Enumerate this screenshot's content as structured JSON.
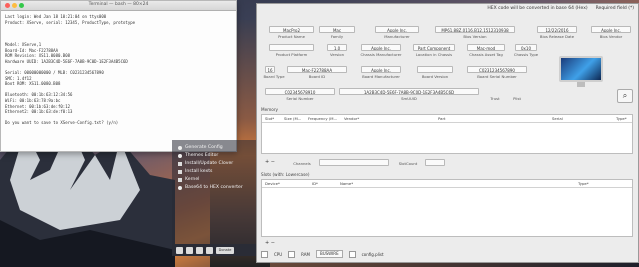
{
  "terminal": {
    "title": "Terminal — bash — 80×24",
    "lines": [
      "Last login: Wed Jan 18 10:21:04 on ttys000",
      "Product: XServe, serial: 12345, ProductType, prototype",
      "",
      "",
      "",
      "Model: XServe,1",
      "Board-Id: Mac-F22788AA",
      "ROM Revision: XS11.0080.B08",
      "Hardware UUID: 1A2B3C4D-5E6F-7A8B-9C0D-1E2F3A4B5C6D",
      "",
      "Serial: 00000000000 / MLB: C0231234567890",
      "SMC: 1.4f12",
      "Boot ROM: XS11.0080.B08",
      "",
      "Bluetooth: 00:1b:63:12:34:56",
      "WiFi: 00:1b:63:78:9a:bc",
      "Ethernet: 00:1b:63:de:f0:12",
      "Ethernet2: 00:1b:63:de:f0:13",
      "",
      "Do you want to save to XServe-Config.txt? (y/n)"
    ]
  },
  "tools": [
    {
      "label": "Generate Config",
      "icon": "radio-icon"
    },
    {
      "label": "Themes Editor",
      "icon": "radio-icon"
    },
    {
      "label": "Install/Update Clover",
      "icon": "checkbox-icon"
    },
    {
      "label": "Install kexts",
      "icon": "checkbox-icon"
    },
    {
      "label": "Kernel",
      "icon": "checkbox-icon"
    },
    {
      "label": "Base64 to HEX converter",
      "icon": "radio-icon"
    }
  ],
  "leftbar": {
    "donate_label": "Donate"
  },
  "main": {
    "notice": "HEX code will be converted in base 64 (Hex)",
    "required_label": "Required field (*)",
    "row1": [
      {
        "value": "MacPro2",
        "label": "Product Name"
      },
      {
        "value": "Mac",
        "label": "Family"
      },
      {
        "value": "Apple Inc.",
        "label": "Manufacturer"
      },
      {
        "value": "MP61.88Z.0116.B12.1512310938",
        "label": "Bios Version"
      },
      {
        "value": "12/22/2016",
        "label": "Bios Release Date"
      },
      {
        "value": "Apple Inc.",
        "label": "Bios Vendor"
      }
    ],
    "row2": [
      {
        "value": "",
        "label": "Product Platform"
      },
      {
        "value": "1.0",
        "label": "Version"
      },
      {
        "value": "Apple Inc.",
        "label": "Chassis Manufacturer"
      },
      {
        "value": "Part Component",
        "label": "Location in Chassis"
      },
      {
        "value": "Mac-mod",
        "label": "Chassis Asset Tag"
      },
      {
        "value": "0x10",
        "label": "Chassis Type"
      }
    ],
    "row3": [
      {
        "value": "16",
        "label": "Board Type"
      },
      {
        "value": "Mac-F22788AA",
        "label": "Board ID"
      },
      {
        "value": "Apple Inc.",
        "label": "Board Manufacturer"
      },
      {
        "value": "",
        "label": "Board Version"
      },
      {
        "value": "C0231234567890",
        "label": "Board Serial Number"
      }
    ],
    "row4": [
      {
        "value": "C02345678910",
        "label": "Serial Number"
      },
      {
        "value": "1A2B3C4D-5E6F-7A8B-9C0D-1E2F3A4B5C6D",
        "label": "SmUUID"
      },
      {
        "value": "",
        "label": "Trust"
      },
      {
        "value": "",
        "label": "Plist"
      }
    ],
    "memory": {
      "title": "Memory",
      "columns": [
        "Slot*",
        "Size (M...",
        "Frequency (M...",
        "Vendor*",
        "Part",
        "Serial",
        "Type*"
      ],
      "channels_label": "Channels",
      "slotcount_label": "SlotCount"
    },
    "slots": {
      "title": "Slots (with: Lowercase)",
      "columns": [
        "Device*",
        "ID*",
        "Name*",
        "Type*"
      ]
    },
    "bottom": {
      "cpu_label": "CPU",
      "mem_label": "RAM",
      "sel_value": "BUSWIRE",
      "config_label": "config.plist"
    }
  }
}
